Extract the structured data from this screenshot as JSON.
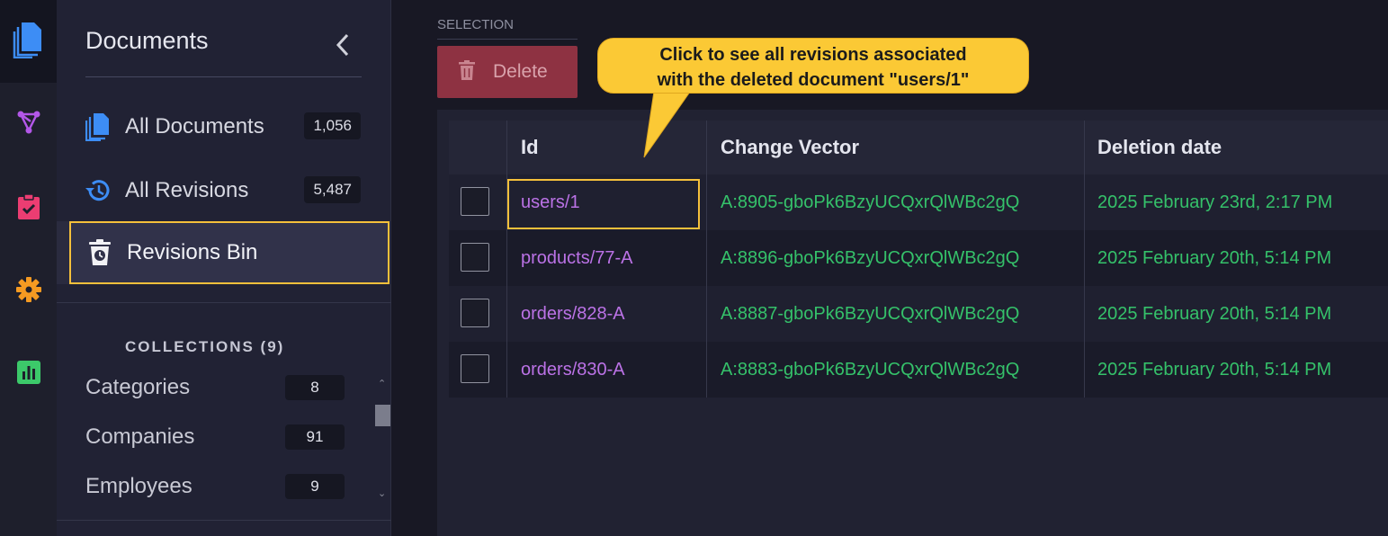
{
  "sidebar": {
    "title": "Documents",
    "nav": [
      {
        "label": "All Documents",
        "count": "1,056",
        "icon": "documents-icon"
      },
      {
        "label": "All Revisions",
        "count": "5,487",
        "icon": "revisions-history-icon"
      },
      {
        "label": "Revisions Bin",
        "icon": "revisions-bin-icon",
        "selected": true
      }
    ],
    "collections_heading": "COLLECTIONS (9)",
    "collections": [
      {
        "label": "Categories",
        "count": "8"
      },
      {
        "label": "Companies",
        "count": "91"
      },
      {
        "label": "Employees",
        "count": "9"
      }
    ]
  },
  "rail": {
    "items": [
      "documents-icon",
      "indexes-icon",
      "tasks-icon",
      "settings-icon",
      "stats-icon"
    ],
    "colors": {
      "documents": "#3d8df5",
      "indexes": "#b357e8",
      "tasks": "#ec3d72",
      "settings": "#f59a22",
      "stats": "#3cc96a"
    }
  },
  "main": {
    "selection_label": "SELECTION",
    "delete_label": "Delete",
    "columns": {
      "id": "Id",
      "change_vector": "Change Vector",
      "deletion_date": "Deletion date"
    },
    "rows": [
      {
        "id": "users/1",
        "change_vector": "A:8905-gboPk6BzyUCQxrQlWBc2gQ",
        "deletion_date": "2025 February 23rd, 2:17 PM"
      },
      {
        "id": "products/77-A",
        "change_vector": "A:8896-gboPk6BzyUCQxrQlWBc2gQ",
        "deletion_date": "2025 February 20th, 5:14 PM"
      },
      {
        "id": "orders/828-A",
        "change_vector": "A:8887-gboPk6BzyUCQxrQlWBc2gQ",
        "deletion_date": "2025 February 20th, 5:14 PM"
      },
      {
        "id": "orders/830-A",
        "change_vector": "A:8883-gboPk6BzyUCQxrQlWBc2gQ",
        "deletion_date": "2025 February 20th, 5:14 PM"
      }
    ]
  },
  "callout": {
    "line1": "Click to see all revisions associated",
    "line2": "with the deleted document \"users/1\""
  },
  "colors": {
    "highlight": "#f5c03b",
    "id_link": "#bb72e6",
    "value_green": "#35c16a",
    "delete_bg": "#8e3242"
  }
}
